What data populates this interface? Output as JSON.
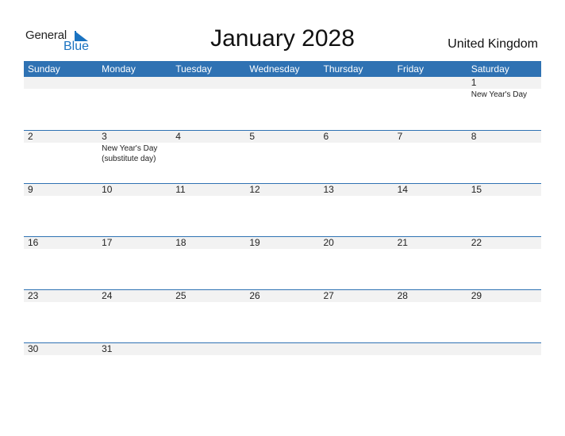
{
  "logo": {
    "general": "General",
    "blue": "Blue"
  },
  "title": "January 2028",
  "country": "United Kingdom",
  "colors": {
    "header_bg": "#2f72b3",
    "band_bg": "#f2f2f2",
    "logo_blue": "#1a73c1"
  },
  "weekdays": [
    "Sunday",
    "Monday",
    "Tuesday",
    "Wednesday",
    "Thursday",
    "Friday",
    "Saturday"
  ],
  "weeks": [
    [
      {
        "day": ""
      },
      {
        "day": ""
      },
      {
        "day": ""
      },
      {
        "day": ""
      },
      {
        "day": ""
      },
      {
        "day": ""
      },
      {
        "day": "1",
        "holiday": "New Year's Day"
      }
    ],
    [
      {
        "day": "2"
      },
      {
        "day": "3",
        "holiday": "New Year's Day (substitute day)"
      },
      {
        "day": "4"
      },
      {
        "day": "5"
      },
      {
        "day": "6"
      },
      {
        "day": "7"
      },
      {
        "day": "8"
      }
    ],
    [
      {
        "day": "9"
      },
      {
        "day": "10"
      },
      {
        "day": "11"
      },
      {
        "day": "12"
      },
      {
        "day": "13"
      },
      {
        "day": "14"
      },
      {
        "day": "15"
      }
    ],
    [
      {
        "day": "16"
      },
      {
        "day": "17"
      },
      {
        "day": "18"
      },
      {
        "day": "19"
      },
      {
        "day": "20"
      },
      {
        "day": "21"
      },
      {
        "day": "22"
      }
    ],
    [
      {
        "day": "23"
      },
      {
        "day": "24"
      },
      {
        "day": "25"
      },
      {
        "day": "26"
      },
      {
        "day": "27"
      },
      {
        "day": "28"
      },
      {
        "day": "29"
      }
    ],
    [
      {
        "day": "30"
      },
      {
        "day": "31"
      },
      {
        "day": ""
      },
      {
        "day": ""
      },
      {
        "day": ""
      },
      {
        "day": ""
      },
      {
        "day": ""
      }
    ]
  ]
}
